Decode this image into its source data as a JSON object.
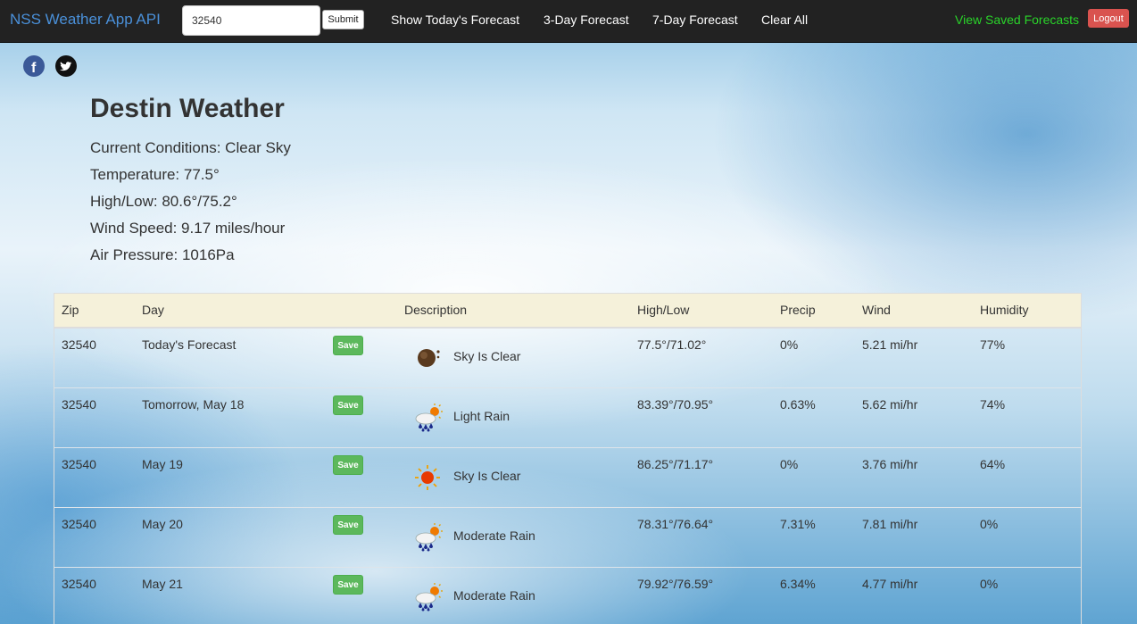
{
  "navbar": {
    "brand": "NSS Weather App API",
    "search_value": "32540",
    "submit_label": "Submit",
    "links": {
      "today": "Show Today's Forecast",
      "three_day": "3-Day Forecast",
      "seven_day": "7-Day Forecast",
      "clear": "Clear All",
      "saved": "View Saved Forecasts"
    },
    "logout_label": "Logout"
  },
  "current": {
    "title": "Destin Weather",
    "conditions": "Current Conditions: Clear Sky",
    "temperature": "Temperature: 77.5°",
    "high_low": "High/Low: 80.6°/75.2°",
    "wind": "Wind Speed: 9.17 miles/hour",
    "pressure": "Air Pressure: 1016Pa"
  },
  "table": {
    "headers": [
      "Zip",
      "Day",
      "Description",
      "High/Low",
      "Precip",
      "Wind",
      "Humidity"
    ],
    "save_label": "Save",
    "rows": [
      {
        "zip": "32540",
        "day": "Today's Forecast",
        "icon": "clear-night-icon",
        "desc": "Sky Is Clear",
        "hilo": "77.5°/71.02°",
        "precip": "0%",
        "wind": "5.21 mi/hr",
        "humidity": "77%"
      },
      {
        "zip": "32540",
        "day": "Tomorrow, May 18",
        "icon": "rain-sun-icon",
        "desc": "Light Rain",
        "hilo": "83.39°/70.95°",
        "precip": "0.63%",
        "wind": "5.62 mi/hr",
        "humidity": "74%"
      },
      {
        "zip": "32540",
        "day": "May 19",
        "icon": "sun-icon",
        "desc": "Sky Is Clear",
        "hilo": "86.25°/71.17°",
        "precip": "0%",
        "wind": "3.76 mi/hr",
        "humidity": "64%"
      },
      {
        "zip": "32540",
        "day": "May 20",
        "icon": "rain-sun-icon",
        "desc": "Moderate Rain",
        "hilo": "78.31°/76.64°",
        "precip": "7.31%",
        "wind": "7.81 mi/hr",
        "humidity": "0%"
      },
      {
        "zip": "32540",
        "day": "May 21",
        "icon": "rain-sun-icon",
        "desc": "Moderate Rain",
        "hilo": "79.92°/76.59°",
        "precip": "6.34%",
        "wind": "4.77 mi/hr",
        "humidity": "0%"
      }
    ]
  }
}
